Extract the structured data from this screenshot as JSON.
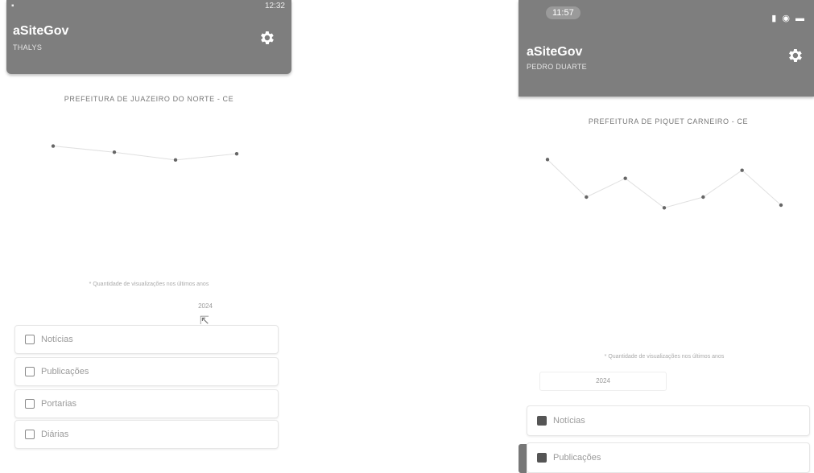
{
  "left": {
    "status_time": "12:32",
    "app_title": "aSiteGov",
    "app_user": "THALYS",
    "municipality": "PREFEITURA DE JUAZEIRO DO NORTE - CE",
    "chart_caption": "* Quantidade de visualizações nos últimos anos",
    "year_value": "2024",
    "menu": [
      {
        "label": "Notícias",
        "icon": "news-icon"
      },
      {
        "label": "Publicações",
        "icon": "publications-icon"
      },
      {
        "label": "Portarias",
        "icon": "ordinances-icon"
      },
      {
        "label": "Diárias",
        "icon": "daily-allowances-icon"
      }
    ]
  },
  "right": {
    "status_time": "11:57",
    "app_title": "aSiteGov",
    "app_user": "PEDRO DUARTE",
    "municipality": "PREFEITURA DE PIQUET CARNEIRO - CE",
    "chart_caption": "* Quantidade de visualizações nos últimos anos",
    "year_value": "2024",
    "menu": [
      {
        "label": "Notícias",
        "icon": "news-icon"
      },
      {
        "label": "Publicações",
        "icon": "publications-icon"
      }
    ]
  },
  "chart_data": [
    {
      "type": "line",
      "categories": [
        "",
        "",
        "",
        ""
      ],
      "values": [
        2000,
        1600,
        1100,
        1500
      ],
      "title": "PREFEITURA DE JUAZEIRO DO NORTE - CE",
      "ylim": [
        0,
        2600
      ]
    },
    {
      "type": "line",
      "categories": [
        "",
        "",
        "",
        "",
        "",
        "",
        ""
      ],
      "values": [
        2600,
        1200,
        1900,
        800,
        1200,
        2200,
        900
      ],
      "title": "PREFEITURA DE PIQUET CARNEIRO - CE",
      "ylim": [
        0,
        3000
      ]
    }
  ],
  "colors": {
    "appbar": "#7e7e7e",
    "line": "#e0e0e0",
    "point": "#666666"
  }
}
